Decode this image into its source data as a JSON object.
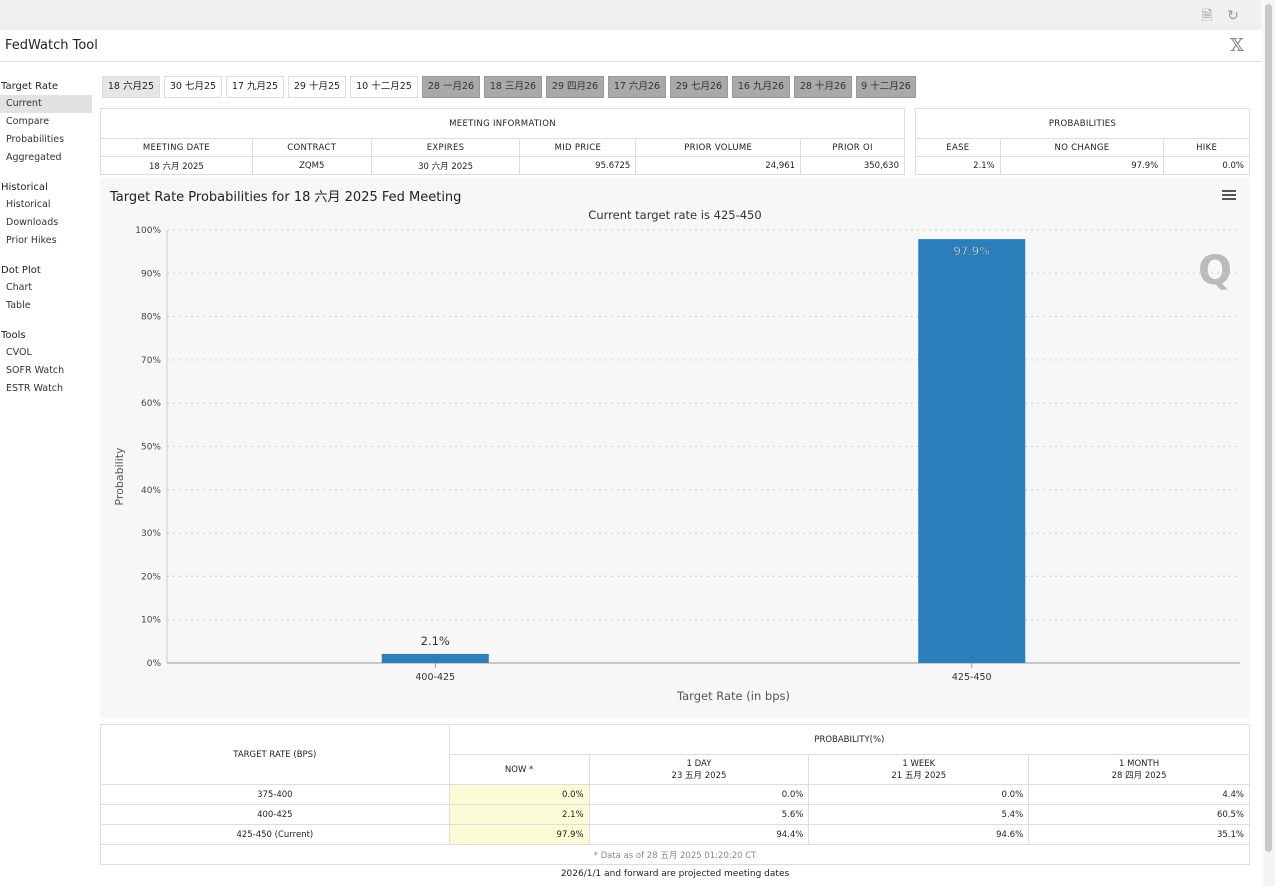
{
  "app": {
    "title": "FedWatch Tool",
    "x_logo": "𝕏"
  },
  "sidebar": {
    "groups": [
      {
        "title": "Target Rate",
        "items": [
          "Current",
          "Compare",
          "Probabilities",
          "Aggregated"
        ]
      },
      {
        "title": "Historical",
        "items": [
          "Historical",
          "Downloads",
          "Prior Hikes"
        ]
      },
      {
        "title": "Dot Plot",
        "items": [
          "Chart",
          "Table"
        ]
      },
      {
        "title": "Tools",
        "items": [
          "CVOL",
          "SOFR Watch",
          "ESTR Watch"
        ]
      }
    ],
    "active_item": "Current"
  },
  "tabs": [
    "18 六月25",
    "30 七月25",
    "17 九月25",
    "29 十月25",
    "10 十二月25",
    "28 一月26",
    "18 三月26",
    "29 四月26",
    "17 六月26",
    "29 七月26",
    "16 九月26",
    "28 十月26",
    "9 十二月26"
  ],
  "meeting_info": {
    "title": "MEETING INFORMATION",
    "headers": [
      "MEETING DATE",
      "CONTRACT",
      "EXPIRES",
      "MID PRICE",
      "PRIOR VOLUME",
      "PRIOR OI"
    ],
    "values": [
      "18 六月 2025",
      "ZQM5",
      "30 六月 2025",
      "95.6725",
      "24,961",
      "350,630"
    ]
  },
  "probabilities": {
    "title": "PROBABILITIES",
    "headers": [
      "EASE",
      "NO CHANGE",
      "HIKE"
    ],
    "values": [
      "2.1%",
      "97.9%",
      "0.0%"
    ]
  },
  "chart": {
    "title": "Target Rate Probabilities for 18 六月 2025 Fed Meeting",
    "subtitle": "Current target rate is 425-450",
    "logo": "Q"
  },
  "chart_data": {
    "type": "bar",
    "title": "Target Rate Probabilities for 18 六月 2025 Fed Meeting",
    "subtitle": "Current target rate is 425-450",
    "categories": [
      "400-425",
      "425-450"
    ],
    "values": [
      2.1,
      97.9
    ],
    "data_labels": [
      "2.1%",
      "97.9%"
    ],
    "xlabel": "Target Rate (in bps)",
    "ylabel": "Probability",
    "ylim": [
      0,
      100
    ],
    "yticks": [
      "0%",
      "10%",
      "20%",
      "30%",
      "40%",
      "50%",
      "60%",
      "70%",
      "80%",
      "90%",
      "100%"
    ],
    "grid": true,
    "bar_color": "#2a7fba"
  },
  "detail": {
    "col_rate": "TARGET RATE (BPS)",
    "col_prob": "PROBABILITY(%)",
    "now": "NOW *",
    "periods": [
      {
        "label": "1 DAY",
        "date": "23 五月 2025"
      },
      {
        "label": "1 WEEK",
        "date": "21 五月 2025"
      },
      {
        "label": "1 MONTH",
        "date": "28 四月 2025"
      }
    ],
    "rows": [
      {
        "rate": "375-400",
        "now": "0.0%",
        "d1": "0.0%",
        "w1": "0.0%",
        "m1": "4.4%"
      },
      {
        "rate": "400-425",
        "now": "2.1%",
        "d1": "5.6%",
        "w1": "5.4%",
        "m1": "60.5%"
      },
      {
        "rate": "425-450 (Current)",
        "now": "97.9%",
        "d1": "94.4%",
        "w1": "94.6%",
        "m1": "35.1%"
      }
    ],
    "note": "* Data as of 28 五月 2025 01:20:20 CT"
  },
  "footer": "2026/1/1 and forward are projected meeting dates"
}
